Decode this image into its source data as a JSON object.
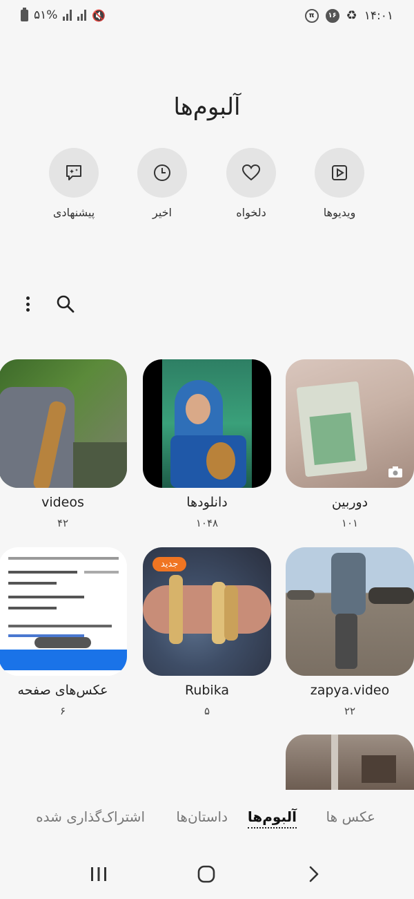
{
  "status_bar": {
    "battery": "۵۱%",
    "time": "۱۴:۰۱",
    "badge_number": "۱۶"
  },
  "page": {
    "title": "آلبوم‌ها"
  },
  "quick_actions": [
    {
      "label": "ویدیوها",
      "icon": "video-icon"
    },
    {
      "label": "دلخواه",
      "icon": "heart-icon"
    },
    {
      "label": "اخیر",
      "icon": "clock-icon"
    },
    {
      "label": "پیشنهادی",
      "icon": "suggestion-icon"
    }
  ],
  "albums": [
    {
      "name": "دوربین",
      "count": "۱۰۱"
    },
    {
      "name": "دانلودها",
      "count": "۱۰۴۸"
    },
    {
      "name": "videos",
      "count": "۴۲"
    },
    {
      "name": "zapya.video",
      "count": "۲۲"
    },
    {
      "name": "Rubika",
      "count": "۵",
      "badge": "جدید"
    },
    {
      "name": "عکس‌های صفحه",
      "count": "۶"
    }
  ],
  "tabs": [
    {
      "label": "عکس ها"
    },
    {
      "label": "آلبوم‌ها",
      "active": true
    },
    {
      "label": "داستان‌ها"
    },
    {
      "label": "اشتراک‌گذاری شده"
    }
  ],
  "colors": {
    "badge": "#f07522",
    "background": "#f6f6f6"
  }
}
